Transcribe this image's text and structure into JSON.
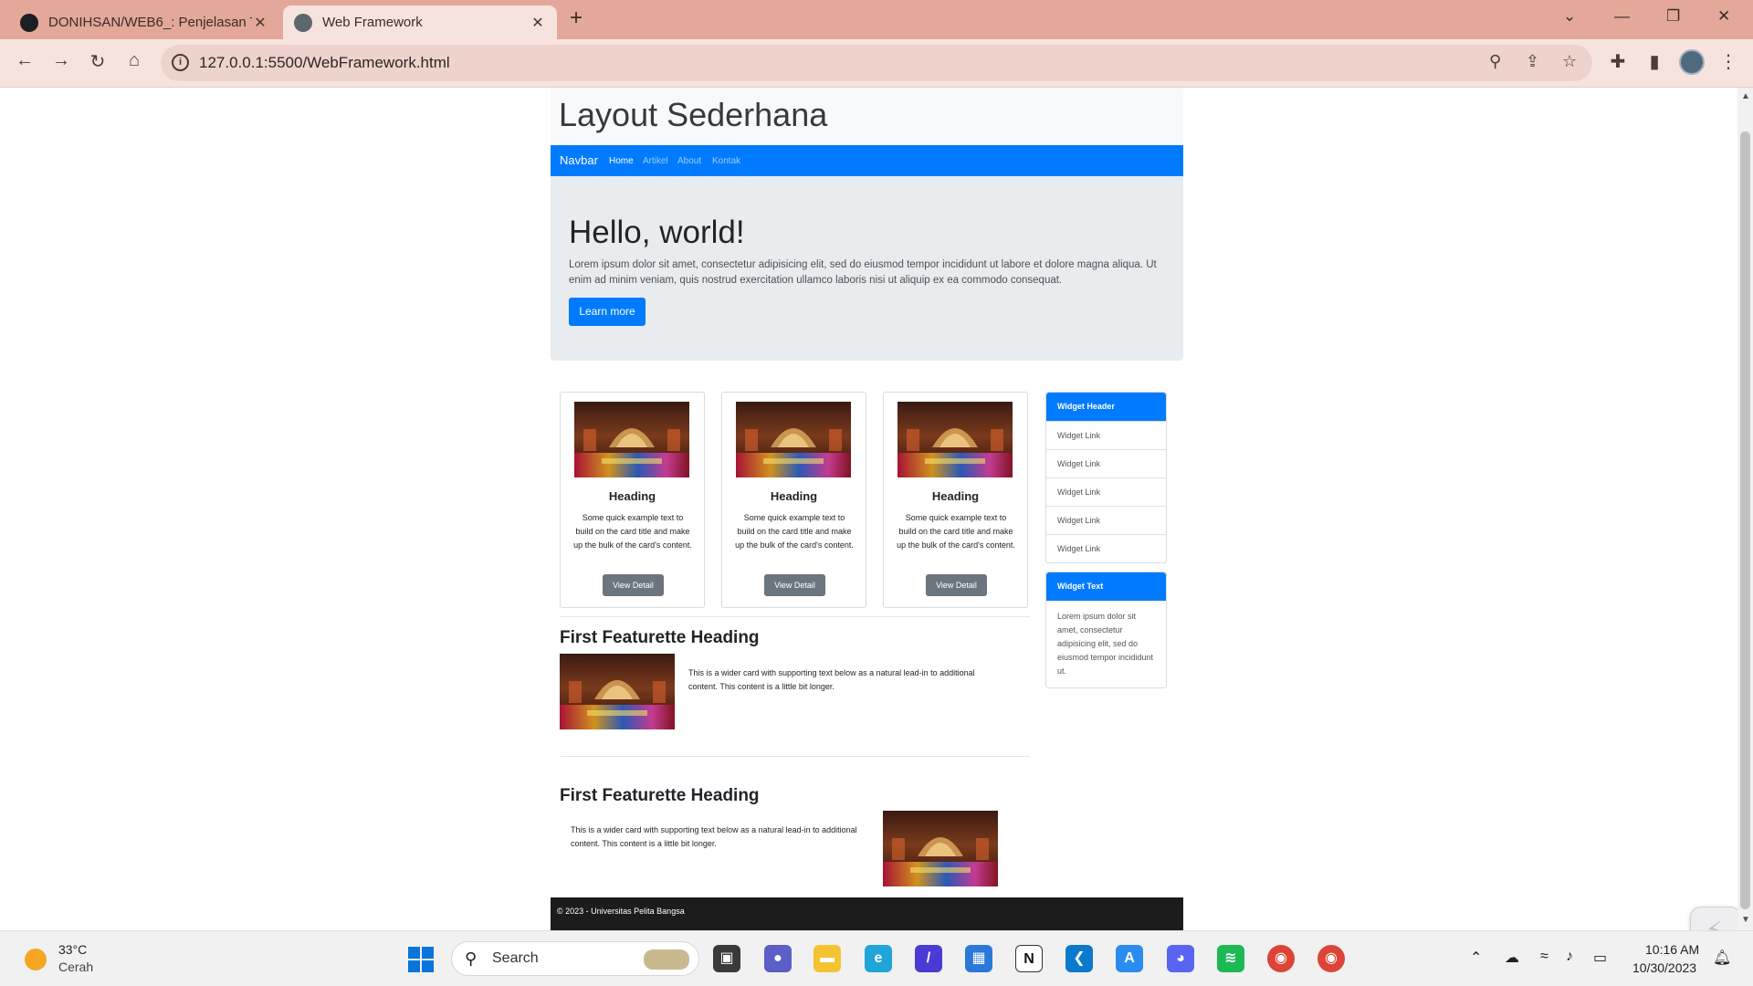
{
  "browser": {
    "tabs": [
      {
        "title": "DONIHSAN/WEB6_: Penjelasan T",
        "close": "✕"
      },
      {
        "title": "Web Framework",
        "close": "✕"
      }
    ],
    "new_tab": "+",
    "url": "127.0.0.1:5500/WebFramework.html",
    "icons": [
      "back-icon",
      "forward-icon",
      "reload-icon",
      "home-icon",
      "info-icon",
      "zoom-icon",
      "share-icon",
      "star-icon",
      "extensions-icon",
      "sidepanel-icon",
      "profile-avatar",
      "menu-icon"
    ],
    "window_controls": {
      "tab_search": "⌄",
      "minimize": "—",
      "restore": "❐",
      "close": "✕"
    }
  },
  "page": {
    "site_title": "Layout Sederhana",
    "navbar": {
      "brand": "Navbar",
      "items": [
        {
          "label": "Home",
          "active": true
        },
        {
          "label": "Artikel",
          "active": false
        },
        {
          "label": "About",
          "active": false
        },
        {
          "label": "Kontak",
          "active": false
        }
      ]
    },
    "jumbotron": {
      "heading": "Hello, world!",
      "text": "Lorem ipsum dolor sit amet, consectetur adipisicing elit, sed do eiusmod tempor incididunt ut labore et dolore magna aliqua. Ut enim ad minim veniam, quis nostrud exercitation ullamco laboris nisi ut aliquip ex ea commodo consequat.",
      "button": "Learn more"
    },
    "cards": [
      {
        "title": "Heading",
        "text": "Some quick example text to build on the card title and make up the bulk of the card's content.",
        "button": "View Detail"
      },
      {
        "title": "Heading",
        "text": "Some quick example text to build on the card title and make up the bulk of the card's content.",
        "button": "View Detail"
      },
      {
        "title": "Heading",
        "text": "Some quick example text to build on the card title and make up the bulk of the card's content.",
        "button": "View Detail"
      }
    ],
    "featurettes": [
      {
        "heading": "First Featurette Heading",
        "text": "This is a wider card with supporting text below as a natural lead-in to additional content. This content is a little bit longer."
      },
      {
        "heading": "First Featurette Heading",
        "text": "This is a wider card with supporting text below as a natural lead-in to additional content. This content is a little bit longer."
      }
    ],
    "widget_links": {
      "header": "Widget Header",
      "links": [
        "Widget Link",
        "Widget Link",
        "Widget Link",
        "Widget Link",
        "Widget Link"
      ]
    },
    "widget_text": {
      "header": "Widget Text",
      "text": "Lorem ipsum dolor sit amet, consectetur adipisicing elit, sed do eiusmod tempor incididunt ut."
    },
    "footer": "© 2023 - Universitas Pelita Bangsa"
  },
  "taskbar": {
    "weather": {
      "temp": "33°C",
      "condition": "Cerah"
    },
    "search_placeholder": "Search",
    "apps": [
      "start-icon",
      "task-view-icon",
      "chat-icon",
      "file-explorer-icon",
      "edge-icon",
      "app-icon",
      "store-icon",
      "notion-icon",
      "vscode-icon",
      "app-store-icon",
      "discord-icon",
      "spotify-icon",
      "chrome-icon",
      "chrome-icon"
    ],
    "time": "10:16 AM",
    "date": "10/30/2023"
  },
  "colors": {
    "tabbar": "#e3a899",
    "primary": "#007bff",
    "secondary": "#6c757d",
    "jumbotron": "#e9ecef",
    "footer": "#1c1c1c"
  }
}
